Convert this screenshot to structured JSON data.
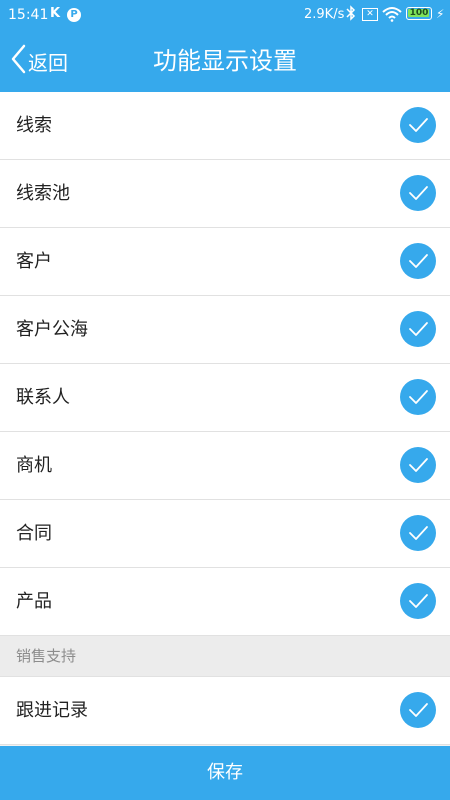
{
  "status_bar": {
    "time": "15:41",
    "app_icon_k": "K",
    "app_icon_p": "P",
    "net_speed": "2.9K/s",
    "bluetooth_icon": "bluetooth-icon",
    "sim_icon": "no-sim-icon",
    "wifi_icon": "wifi-icon",
    "battery_level": "100",
    "charging_icon": "charging-icon"
  },
  "header": {
    "back_label": "返回",
    "back_icon": "chevron-left-icon",
    "title": "功能显示设置"
  },
  "items": [
    {
      "label": "线索",
      "checked": true
    },
    {
      "label": "线索池",
      "checked": true
    },
    {
      "label": "客户",
      "checked": true
    },
    {
      "label": "客户公海",
      "checked": true
    },
    {
      "label": "联系人",
      "checked": true
    },
    {
      "label": "商机",
      "checked": true
    },
    {
      "label": "合同",
      "checked": true
    },
    {
      "label": "产品",
      "checked": true
    }
  ],
  "section": {
    "label": "销售支持",
    "items": [
      {
        "label": "跟进记录",
        "checked": true
      }
    ]
  },
  "footer": {
    "save_label": "保存"
  },
  "colors": {
    "primary": "#36a9ec",
    "background": "#f2f2f2",
    "section_bg": "#ececec",
    "battery_green": "#7ee35a"
  }
}
